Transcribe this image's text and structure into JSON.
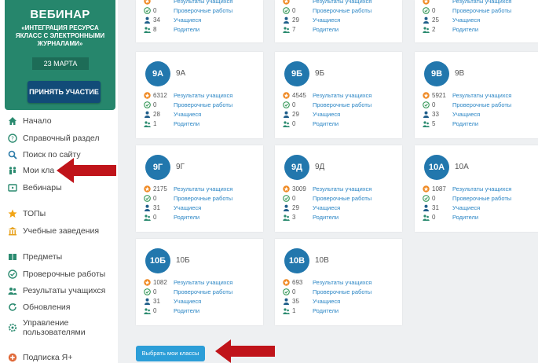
{
  "promo": {
    "title": "ВЕБИНАР",
    "subtitle": "«ИНТЕГРАЦИЯ РЕСУРСА ЯКЛАСС С ЭЛЕКТРОННЫМИ ЖУРНАЛАМИ»",
    "date": "23 МАРТА",
    "button": "ПРИНЯТЬ УЧАСТИЕ"
  },
  "nav": [
    {
      "id": "home",
      "label": "Начало",
      "icon": "home-icon"
    },
    {
      "id": "help",
      "label": "Справочный раздел",
      "icon": "help-icon"
    },
    {
      "id": "search",
      "label": "Поиск по сайту",
      "icon": "search-icon"
    },
    {
      "id": "my-classes",
      "label": "Мои кла",
      "icon": "class-icon"
    },
    {
      "id": "webinars",
      "label": "Вебинары",
      "icon": "webinar-icon"
    },
    {
      "id": "tops",
      "label": "ТОПы",
      "icon": "star-icon"
    },
    {
      "id": "schools",
      "label": "Учебные заведения",
      "icon": "school-icon"
    },
    {
      "id": "subjects",
      "label": "Предметы",
      "icon": "book-icon"
    },
    {
      "id": "tests",
      "label": "Проверочные работы",
      "icon": "check-circle-icon"
    },
    {
      "id": "results",
      "label": "Результаты учащихся",
      "icon": "users-icon"
    },
    {
      "id": "updates",
      "label": "Обновления",
      "icon": "refresh-icon"
    },
    {
      "id": "manage",
      "label": "Управление\nпользователями",
      "icon": "manage-users-icon"
    },
    {
      "id": "subscribe",
      "label": "Подписка Я+",
      "icon": "plus-icon"
    }
  ],
  "row_labels": {
    "results": "Результаты учащихся",
    "tests": "Проверочные работы",
    "students": "Учащиеся",
    "parents": "Родители"
  },
  "top_partial": [
    {
      "results": "",
      "tests": "0",
      "students": "34",
      "parents": "8"
    },
    {
      "results": "",
      "tests": "0",
      "students": "29",
      "parents": "7"
    },
    {
      "results": "",
      "tests": "0",
      "students": "25",
      "parents": "2"
    }
  ],
  "classes": [
    {
      "badge": "9А",
      "name": "9А",
      "results": "6312",
      "tests": "0",
      "students": "28",
      "parents": "1"
    },
    {
      "badge": "9Б",
      "name": "9Б",
      "results": "4545",
      "tests": "0",
      "students": "29",
      "parents": "0"
    },
    {
      "badge": "9В",
      "name": "9В",
      "results": "5921",
      "tests": "0",
      "students": "33",
      "parents": "5"
    },
    {
      "badge": "9Г",
      "name": "9Г",
      "results": "2175",
      "tests": "0",
      "students": "31",
      "parents": "0"
    },
    {
      "badge": "9Д",
      "name": "9Д",
      "results": "3009",
      "tests": "0",
      "students": "29",
      "parents": "3"
    },
    {
      "badge": "10А",
      "name": "10А",
      "results": "1087",
      "tests": "0",
      "students": "31",
      "parents": "0"
    },
    {
      "badge": "10Б",
      "name": "10Б",
      "results": "1082",
      "tests": "0",
      "students": "31",
      "parents": "0"
    },
    {
      "badge": "10В",
      "name": "10В",
      "results": "693",
      "tests": "0",
      "students": "35",
      "parents": "1"
    }
  ],
  "choose_button": "Выбрать мои классы",
  "colors": {
    "promo": "#26866c",
    "badge": "#2277ad",
    "link": "#2b86c5",
    "arrow": "#c0141a",
    "button": "#2c9ed8"
  }
}
